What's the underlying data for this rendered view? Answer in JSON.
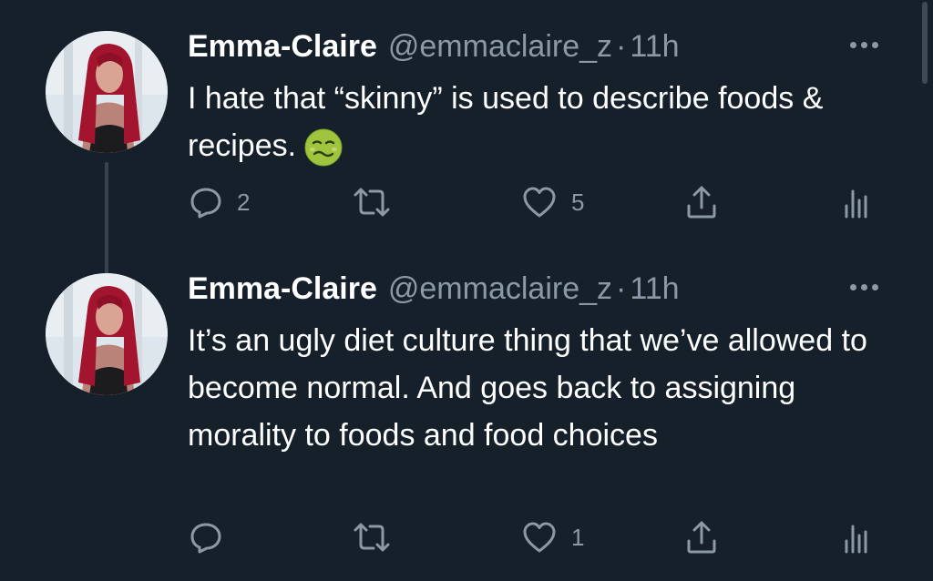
{
  "colors": {
    "background": "#15202b",
    "text_primary": "#ffffff",
    "text_secondary": "#8b98a5",
    "thread_line": "#38444d"
  },
  "tweets": [
    {
      "name": "Emma-Claire",
      "handle": "@emmaclaire_z",
      "separator": "·",
      "time": "11h",
      "text": "I hate that “skinny” is used to describe foods & recipes.",
      "emoji": "nauseated-face",
      "reply_count": "2",
      "retweet_count": "",
      "like_count": "5",
      "icons": [
        "reply-icon",
        "retweet-icon",
        "like-icon",
        "share-icon",
        "analytics-icon"
      ]
    },
    {
      "name": "Emma-Claire",
      "handle": "@emmaclaire_z",
      "separator": "·",
      "time": "11h",
      "text": "It’s an ugly diet culture thing that we’ve allowed to become normal. And goes back to assigning morality to foods and food choices",
      "reply_count": "",
      "retweet_count": "",
      "like_count": "1",
      "icons": [
        "reply-icon",
        "retweet-icon",
        "like-icon",
        "share-icon",
        "analytics-icon"
      ]
    }
  ]
}
